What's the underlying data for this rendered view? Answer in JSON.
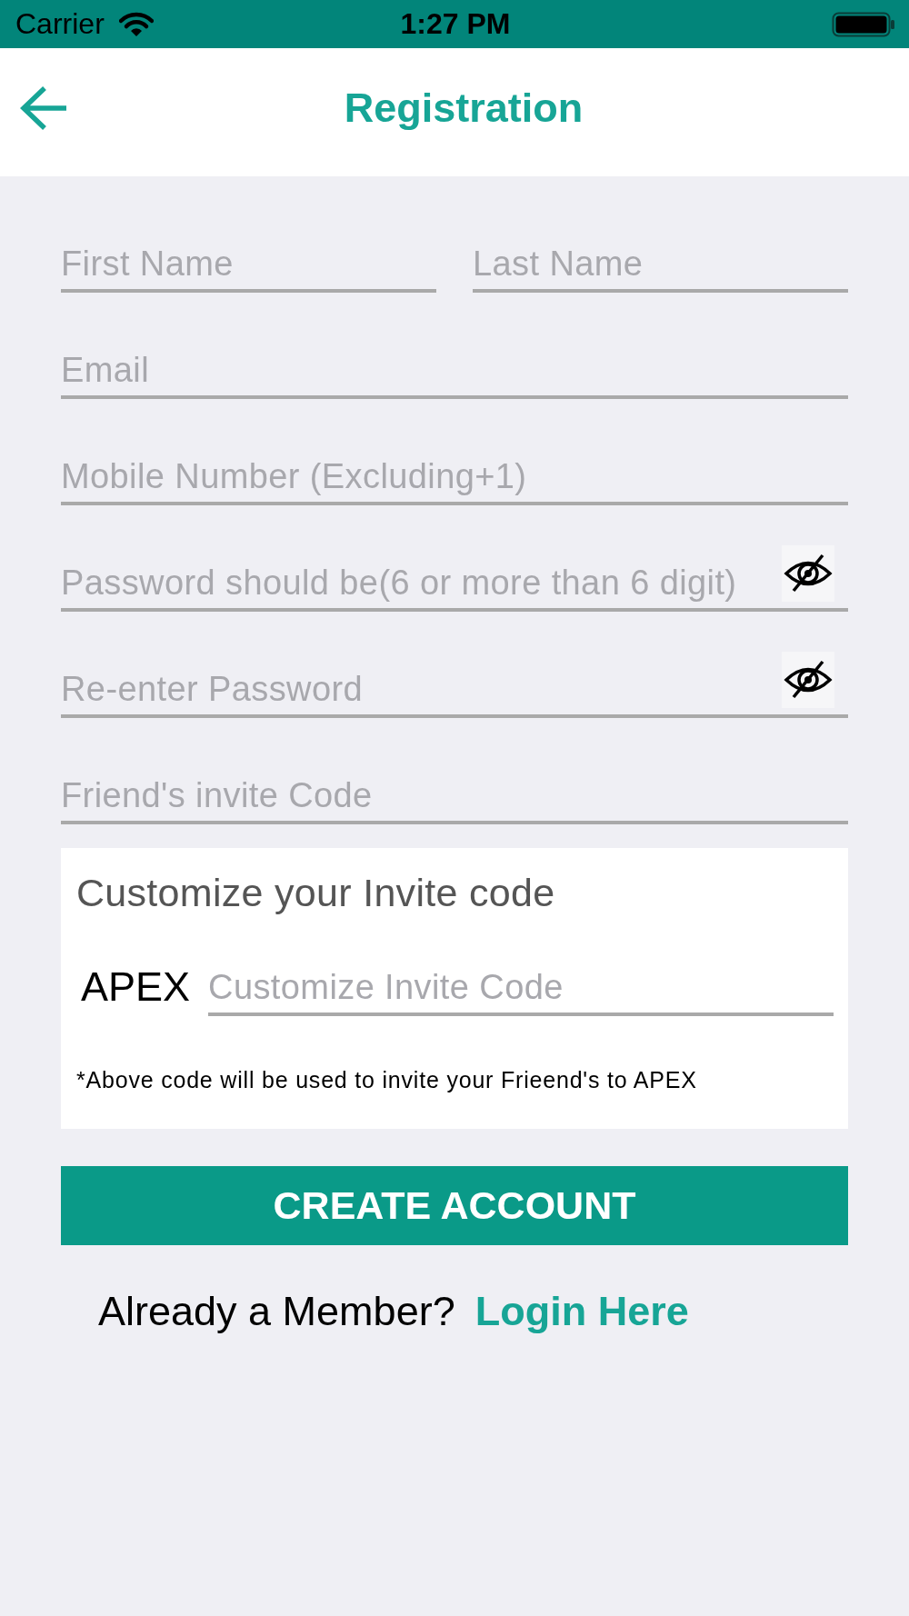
{
  "status_bar": {
    "carrier": "Carrier",
    "time": "1:27 PM"
  },
  "header": {
    "title": "Registration"
  },
  "form": {
    "name_row": [
      {
        "placeholder": "First Name"
      },
      {
        "placeholder": "Last Name"
      }
    ],
    "fields": [
      {
        "kind": "text",
        "placeholder": "Email"
      },
      {
        "kind": "text",
        "placeholder": "Mobile Number (Excluding+1)"
      },
      {
        "kind": "password",
        "placeholder": "Password should be(6 or more than 6 digit)",
        "shown": false
      },
      {
        "kind": "password",
        "placeholder": "Re-enter Password",
        "shown": false
      },
      {
        "kind": "text",
        "placeholder": "Friend's invite Code"
      }
    ]
  },
  "invite_card": {
    "title": "Customize your Invite code",
    "prefix": "APEX",
    "placeholder": "Customize Invite Code",
    "note": "*Above code will be used to invite your Frieend's to APEX"
  },
  "create_button": "CREATE ACCOUNT",
  "login_prompt": {
    "text": "Already a Member?",
    "link": "Login Here"
  }
}
